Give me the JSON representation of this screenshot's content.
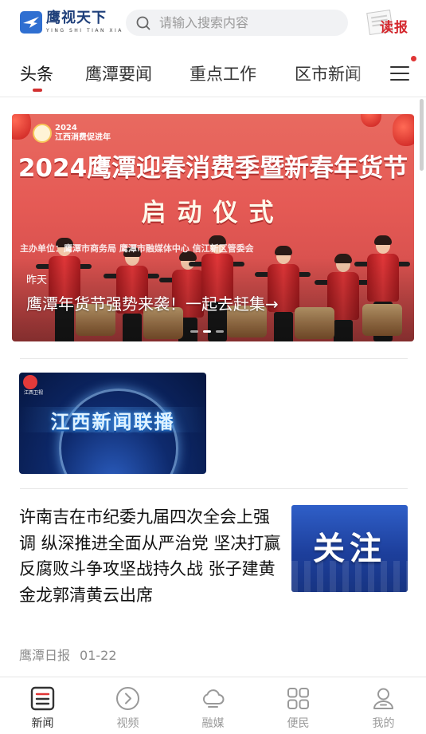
{
  "header": {
    "logo_cn": "鹰视天下",
    "logo_en": "YING SHI TIAN XIA",
    "search_placeholder": "请输入搜索内容",
    "read_label": "读报"
  },
  "tabs": [
    {
      "label": "头条",
      "active": true
    },
    {
      "label": "鹰潭要闻",
      "active": false
    },
    {
      "label": "重点工作",
      "active": false
    },
    {
      "label": "区市新闻",
      "active": false
    }
  ],
  "banner": {
    "badge_year": "2024",
    "badge_text": "江西消费促进年",
    "title": "2024鹰潭迎春消费季暨新春年货节",
    "subtitle": "启动仪式",
    "organizer": "主办单位：鹰潭市商务局    鹰潭市融媒体中心    信江新区管委会",
    "date": "昨天",
    "caption": "鹰潭年货节强势来袭！一起去赶集→",
    "dots": 3,
    "active_dot": 1
  },
  "video": {
    "title": "江西新闻联播",
    "logo_text": "江西卫视"
  },
  "article": {
    "title": "许南吉在市纪委九届四次全会上强调 纵深推进全面从严治党 坚决打赢反腐败斗争攻坚战持久战 张子建黄金龙郭清黄云出席",
    "thumb_text": "关注",
    "source": "鹰潭日报",
    "date": "01-22"
  },
  "bottom_nav": [
    {
      "label": "新闻",
      "icon": "news-icon",
      "active": true
    },
    {
      "label": "视频",
      "icon": "video-play-icon",
      "active": false
    },
    {
      "label": "融媒",
      "icon": "cloud-icon",
      "active": false
    },
    {
      "label": "便民",
      "icon": "grid-icon",
      "active": false
    },
    {
      "label": "我的",
      "icon": "user-icon",
      "active": false
    }
  ],
  "colors": {
    "accent_red": "#d23030",
    "brand_blue": "#2f6fd1"
  }
}
